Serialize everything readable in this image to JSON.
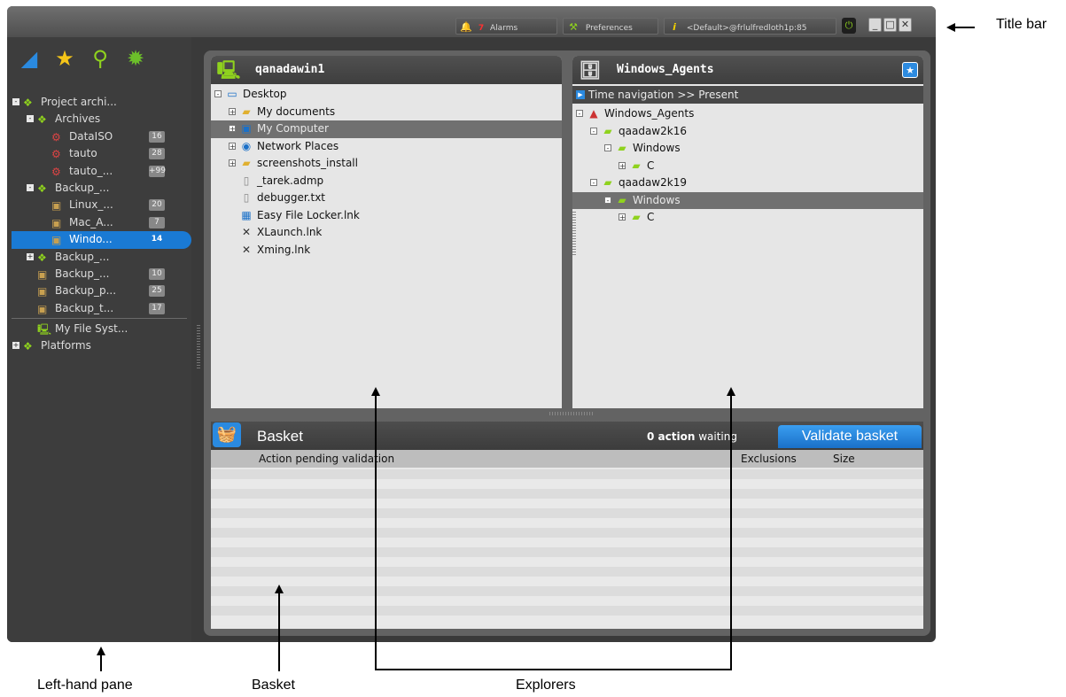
{
  "titlebar": {
    "alarms_count": "7",
    "alarms_label": "Alarms",
    "preferences_label": "Preferences",
    "user_label": "<Default>@frlulfredloth1p:85",
    "minimize": "_",
    "maximize": "□",
    "close": "✕"
  },
  "left_pane": {
    "toolbar": [
      {
        "name": "folder-icon",
        "glyph": "◢",
        "color": "#2a8ae0"
      },
      {
        "name": "star-icon",
        "glyph": "★",
        "color": "#f5c518"
      },
      {
        "name": "search-icon",
        "glyph": "⚲",
        "color": "#8fd21e"
      },
      {
        "name": "gear-icon",
        "glyph": "✹",
        "color": "#6cbf2a"
      }
    ],
    "tree": [
      {
        "label": "Project archi...",
        "level": 0,
        "expander": "-",
        "icon": "project"
      },
      {
        "label": "Archives",
        "level": 1,
        "expander": "-",
        "icon": "project"
      },
      {
        "label": "DataISO",
        "level": 2,
        "badge": "16",
        "icon": "archive"
      },
      {
        "label": "tauto",
        "level": 2,
        "badge": "28",
        "icon": "archive"
      },
      {
        "label": "tauto_...",
        "level": 2,
        "badge": "+99",
        "icon": "archive"
      },
      {
        "label": "Backup_...",
        "level": 1,
        "expander": "-",
        "icon": "project"
      },
      {
        "label": "Linux_...",
        "level": 2,
        "badge": "20",
        "icon": "backup"
      },
      {
        "label": "Mac_A...",
        "level": 2,
        "badge": "7",
        "icon": "backup"
      },
      {
        "label": "Windo...",
        "level": 2,
        "badge": "14",
        "icon": "backup",
        "selected": true
      },
      {
        "label": "Backup_...",
        "level": 1,
        "expander": "+",
        "icon": "project"
      },
      {
        "label": "Backup_...",
        "level": 1,
        "badge": "10",
        "icon": "backup"
      },
      {
        "label": "Backup_p...",
        "level": 1,
        "badge": "25",
        "icon": "backup"
      },
      {
        "label": "Backup_t...",
        "level": 1,
        "badge": "17",
        "icon": "backup"
      }
    ],
    "tree2": [
      {
        "label": "My File Syst...",
        "level": 1,
        "icon": "filesystem"
      },
      {
        "label": "Platforms",
        "level": 0,
        "expander": "+",
        "icon": "project"
      }
    ]
  },
  "explorer_left": {
    "title": "qanadawin1",
    "rows": [
      {
        "label": "Desktop",
        "level": 0,
        "box": "-",
        "icon": "desktop"
      },
      {
        "label": "My documents",
        "level": 1,
        "box": "+",
        "icon": "folder"
      },
      {
        "label": "My Computer",
        "level": 1,
        "box": "+",
        "icon": "computer",
        "highlight": true
      },
      {
        "label": "Network Places",
        "level": 1,
        "box": "+",
        "icon": "network"
      },
      {
        "label": "screenshots_install",
        "level": 1,
        "box": "+",
        "icon": "folder"
      },
      {
        "label": "_tarek.admp",
        "level": 1,
        "icon": "file"
      },
      {
        "label": "debugger.txt",
        "level": 1,
        "icon": "file"
      },
      {
        "label": "Easy File Locker.lnk",
        "level": 1,
        "icon": "shortcut"
      },
      {
        "label": "XLaunch.lnk",
        "level": 1,
        "icon": "x"
      },
      {
        "label": "Xming.lnk",
        "level": 1,
        "icon": "x"
      }
    ]
  },
  "explorer_right": {
    "title": "Windows_Agents",
    "time_nav": "Time navigation >> Present",
    "rows": [
      {
        "label": "Windows_Agents",
        "level": 0,
        "box": "-",
        "icon": "agents"
      },
      {
        "label": "qaadaw2k16",
        "level": 1,
        "box": "-",
        "icon": "greenfolder"
      },
      {
        "label": "Windows",
        "level": 2,
        "box": "-",
        "icon": "greenfolder"
      },
      {
        "label": "C",
        "level": 3,
        "box": "+",
        "icon": "greenfolder"
      },
      {
        "label": "qaadaw2k19",
        "level": 1,
        "box": "-",
        "icon": "greenfolder"
      },
      {
        "label": "Windows",
        "level": 2,
        "box": "-",
        "icon": "greenfolder",
        "highlight": true
      },
      {
        "label": "C",
        "level": 3,
        "box": "+",
        "icon": "greenfolder"
      }
    ]
  },
  "basket": {
    "title": "Basket",
    "count": "0 action",
    "status": "waiting",
    "validate_label": "Validate basket",
    "columns": {
      "action": "Action pending validation",
      "exclusions": "Exclusions",
      "size": "Size"
    }
  },
  "annotations": {
    "title_bar": "Title bar",
    "left_pane": "Left-hand pane",
    "basket": "Basket",
    "explorers": "Explorers"
  }
}
